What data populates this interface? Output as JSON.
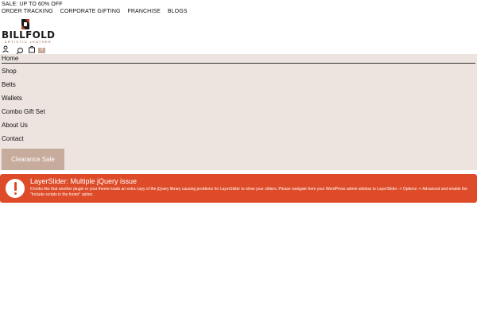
{
  "topbar": {
    "sale_text": "SALE: UP TO 60% OFF",
    "links": [
      "ORDER TRACKING",
      "CORPORATE GIFTING",
      "FRANCHISE",
      "BLOGS"
    ]
  },
  "logo": {
    "name": "BILLFOLD",
    "tagline": "ARTISTIC LEATHER"
  },
  "header_icons": {
    "account": "user-icon",
    "search": "search-icon",
    "cart": "shopping-bag-icon",
    "cart_count": "0"
  },
  "nav": {
    "items": [
      "Home",
      "Shop",
      "Belts",
      "Wallets",
      "Combo Gift Set",
      "About Us",
      "Contact"
    ],
    "clearance_label": "Clearance Sale"
  },
  "alert": {
    "title": "LayerSlider: Multiple jQuery issue",
    "message": "It looks like that another plugin or your theme loads an extra copy of the jQuery library causing problems for LayerSlider to show your sliders. Please navigate from your WordPress admin sidebar to LayerSlider -> Options -> Advanced and enable the \"Include scripts in the footer\" option.",
    "icon": "exclamation-icon"
  },
  "colors": {
    "nav_background": "#ede4df",
    "clearance_button": "#c7ab9c",
    "alert_background": "#de4b28"
  }
}
